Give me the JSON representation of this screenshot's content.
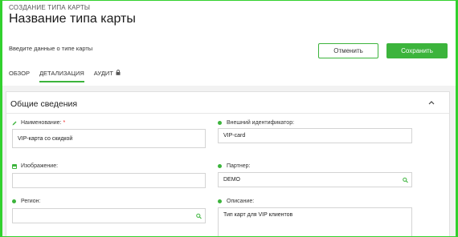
{
  "header": {
    "breadcrumb": "СОЗДАНИЕ ТИПА КАРТЫ",
    "title": "Название типа карты",
    "subtitle": "Введите данные о типе карты",
    "cancel_label": "Отменить",
    "save_label": "Сохранить"
  },
  "tabs": [
    {
      "label": "ОБЗОР",
      "active": false
    },
    {
      "label": "ДЕТАЛИЗАЦИЯ",
      "active": true
    },
    {
      "label": "АУДИТ",
      "active": false,
      "icon": "lock-icon"
    }
  ],
  "section": {
    "title": "Общие сведения",
    "collapse_icon": "chevron-up-icon"
  },
  "fields": {
    "name": {
      "label": "Наименование:",
      "required_mark": "*",
      "value": "VIP-карта со скидкой",
      "icon": "edit-icon"
    },
    "external_id": {
      "label": "Внешний идентификатор:",
      "value": "VIP-card"
    },
    "image": {
      "label": "Изображение:",
      "value": "",
      "icon": "image-icon"
    },
    "partner": {
      "label": "Партнер:",
      "value": "DEMO",
      "icon": "search-icon"
    },
    "region": {
      "label": "Регион:",
      "value": "",
      "icon": "search-icon"
    },
    "description": {
      "label": "Описание:",
      "value": "Тип карт для VIP клиентов"
    }
  },
  "colors": {
    "accent": "#3cb43c",
    "frame": "#32d12e",
    "required": "#ee2222"
  }
}
